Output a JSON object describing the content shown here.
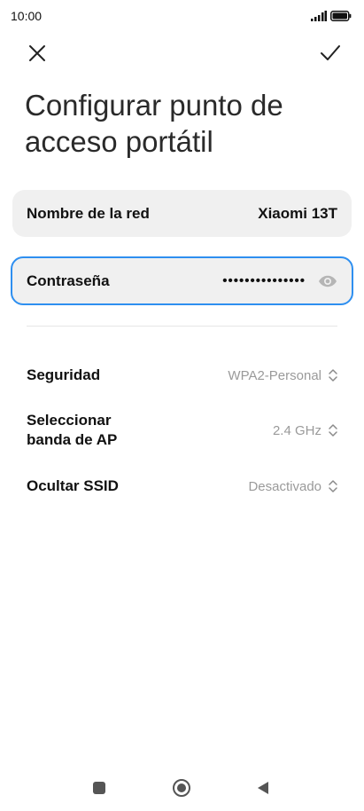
{
  "status_bar": {
    "time": "10:00",
    "icons": [
      "signal-icon",
      "battery-icon"
    ]
  },
  "top_bar": {
    "icons": [
      "close-icon",
      "check-icon"
    ]
  },
  "page": {
    "title": "Configurar punto de acceso portátil"
  },
  "network_field": {
    "label": "Nombre de la red",
    "value": "Xiaomi 13T"
  },
  "password_field": {
    "label": "Contraseña",
    "value": "•••••••••••••••",
    "icon": "eye-icon",
    "focus_color": "#2e8ff0"
  },
  "settings": {
    "security": {
      "label": "Seguridad",
      "value": "WPA2-Personal"
    },
    "band": {
      "label": "Seleccionar banda de AP",
      "value": "2.4 GHz"
    },
    "ssid": {
      "label": "Ocultar SSID",
      "value": "Desactivado"
    }
  },
  "nav_bar": {
    "icons": [
      "recent-apps-icon",
      "home-icon",
      "back-icon"
    ]
  }
}
